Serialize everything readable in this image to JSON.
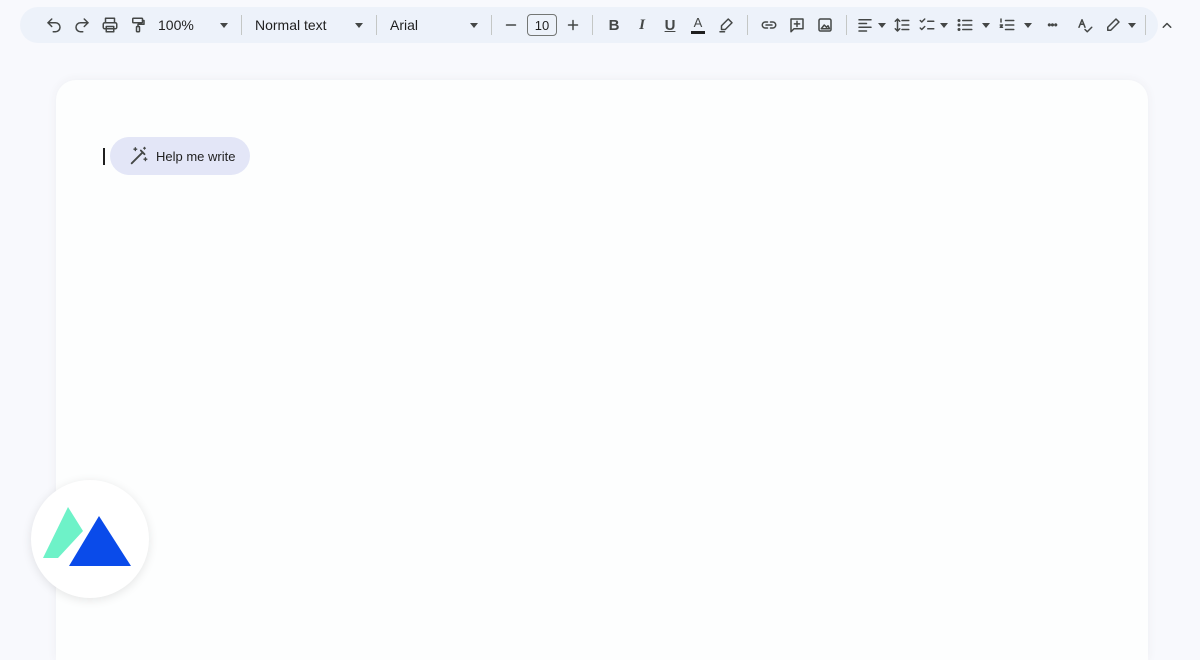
{
  "toolbar": {
    "zoom": "100%",
    "style": "Normal text",
    "font": "Arial",
    "font_size": "10",
    "bold_label": "B",
    "italic_label": "I",
    "underline_label": "U",
    "text_color_label": "A",
    "more_label": "•••"
  },
  "document": {
    "help_me_write": "Help me write"
  },
  "colors": {
    "toolbar_bg": "#edf2fa",
    "help_chip_bg": "#e3e6f7",
    "logo_blue": "#0a4bea",
    "logo_green": "#6ef2c8"
  },
  "icons": [
    "undo-icon",
    "redo-icon",
    "print-icon",
    "paint-format-icon",
    "minus-icon",
    "plus-icon",
    "highlighter-icon",
    "link-icon",
    "add-comment-icon",
    "insert-image-icon",
    "align-left-icon",
    "line-spacing-icon",
    "checklist-icon",
    "bulleted-list-icon",
    "numbered-list-icon",
    "spellcheck-icon",
    "editing-mode-pencil-icon",
    "collapse-chevron-up-icon",
    "sparkle-pen-icon"
  ]
}
